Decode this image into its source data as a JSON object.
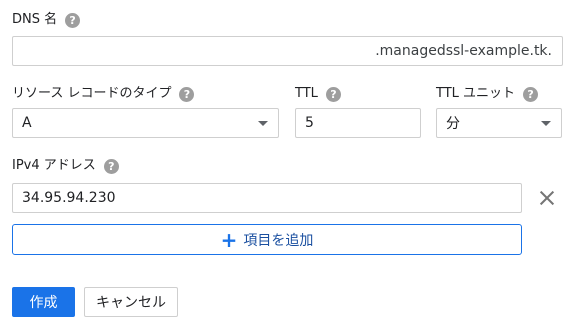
{
  "dns_name": {
    "label": "DNS 名",
    "help": "?",
    "value": "",
    "suffix": ".managedssl-example.tk."
  },
  "record_type": {
    "label": "リソース レコードのタイプ",
    "help": "?",
    "selected": "A"
  },
  "ttl": {
    "label": "TTL",
    "help": "?",
    "value": "5"
  },
  "ttl_unit": {
    "label": "TTL ユニット",
    "help": "?",
    "selected": "分"
  },
  "ipv4": {
    "label": "IPv4 アドレス",
    "help": "?",
    "value": "34.95.94.230"
  },
  "add_item": {
    "icon": "plus-icon",
    "label": "項目を追加"
  },
  "buttons": {
    "create": "作成",
    "cancel": "キャンセル"
  },
  "colors": {
    "accent": "#1a73e8",
    "border": "#cfcfcf",
    "help_icon": "#9e9e9e"
  }
}
